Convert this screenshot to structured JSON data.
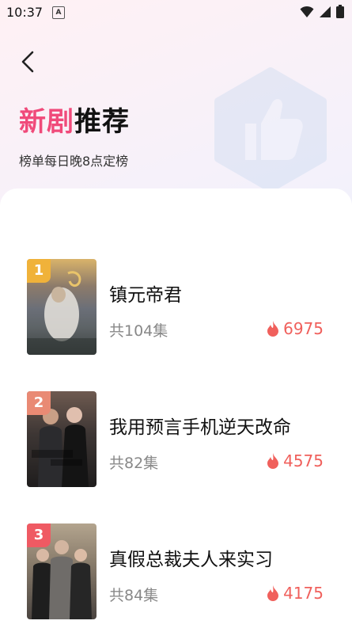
{
  "status_bar": {
    "time": "10:37",
    "notification_glyph": "A"
  },
  "header": {
    "title_highlight": "新剧",
    "title_rest": "推荐",
    "subtitle": "榜单每日晚8点定榜"
  },
  "colors": {
    "accent_pink": "#f04a7a",
    "heat_red": "#f0605c",
    "rank_1": "#f0b23a",
    "rank_2": "#e98a74",
    "rank_3": "#ef5a63"
  },
  "list": [
    {
      "rank": "1",
      "title": "镇元帝君",
      "episodes": "共104集",
      "heat": "6975"
    },
    {
      "rank": "2",
      "title": "我用预言手机逆天改命",
      "episodes": "共82集",
      "heat": "4575"
    },
    {
      "rank": "3",
      "title": "真假总裁夫人来实习",
      "episodes": "共84集",
      "heat": "4175"
    }
  ]
}
